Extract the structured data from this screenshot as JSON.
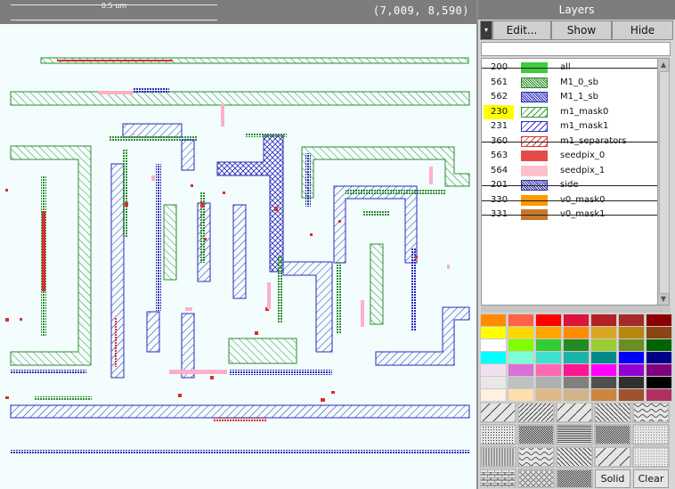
{
  "scale_label": "0.5 um",
  "coordinates": "(7,009, 8,590)",
  "panel": {
    "title": "Layers",
    "toolbar": {
      "arrow": "▾",
      "edit": "Edit...",
      "show": "Show",
      "hide": "Hide"
    },
    "filter_value": ""
  },
  "layers": [
    {
      "num": "200",
      "name": "all",
      "color": "#3fcc3f",
      "pattern": "solid-light",
      "struck": true,
      "highlight": false
    },
    {
      "num": "561",
      "name": "M1_0_sb",
      "color": "#2a8a2a",
      "pattern": "dense",
      "struck": false,
      "highlight": false
    },
    {
      "num": "562",
      "name": "M1_1_sb",
      "color": "#2a2ab8",
      "pattern": "dense",
      "struck": false,
      "highlight": false
    },
    {
      "num": "230",
      "name": "m1_mask0",
      "color": "#2e9a2e",
      "pattern": "hatch",
      "struck": false,
      "highlight": true
    },
    {
      "num": "231",
      "name": "m1_mask1",
      "color": "#2f2fc8",
      "pattern": "hatch",
      "struck": false,
      "highlight": false
    },
    {
      "num": "360",
      "name": "m1_separators",
      "color": "#e03030",
      "pattern": "hatch",
      "struck": true,
      "highlight": false
    },
    {
      "num": "563",
      "name": "seedpix_0",
      "color": "#e84a4a",
      "pattern": "solid-light",
      "struck": false,
      "highlight": false
    },
    {
      "num": "564",
      "name": "seedpix_1",
      "color": "#ffc0cc",
      "pattern": "solid",
      "struck": false,
      "highlight": false
    },
    {
      "num": "201",
      "name": "side",
      "color": "#2a2aa0",
      "pattern": "dense",
      "struck": true,
      "highlight": false
    },
    {
      "num": "330",
      "name": "v0_mask0",
      "color": "#ff9a00",
      "pattern": "solid",
      "struck": true,
      "highlight": false
    },
    {
      "num": "331",
      "name": "v0_mask1",
      "color": "#c8782a",
      "pattern": "solid",
      "struck": true,
      "highlight": false
    }
  ],
  "palette": [
    [
      "#ff8c00",
      "#ff6347",
      "#ff0000",
      "#dc143c",
      "#b22222",
      "#a52a2a",
      "#8b0000"
    ],
    [
      "#ffff00",
      "#ffd700",
      "#ffa500",
      "#ff8c00",
      "#daa520",
      "#b8860b",
      "#8b4513"
    ],
    [
      "#ffffff",
      "#7fff00",
      "#32cd32",
      "#228b22",
      "#9acd32",
      "#6b8e23",
      "#006400"
    ],
    [
      "#00ffff",
      "#7fffd4",
      "#40e0d0",
      "#20b2aa",
      "#008b8b",
      "#0000ff",
      "#00008b"
    ],
    [
      "#f0e0f0",
      "#da70d6",
      "#ff69b4",
      "#ff1493",
      "#ff00ff",
      "#9400d3",
      "#800080"
    ],
    [
      "#e8e8e8",
      "#c0c0c0",
      "#b0b0b0",
      "#808080",
      "#505050",
      "#303030",
      "#000000"
    ],
    [
      "#fff0e0",
      "#ffdead",
      "#deb887",
      "#d2b48c",
      "#cd853f",
      "#a0522d",
      "#b03060"
    ]
  ],
  "patterns": {
    "solid_label": "Solid",
    "clear_label": "Clear"
  }
}
